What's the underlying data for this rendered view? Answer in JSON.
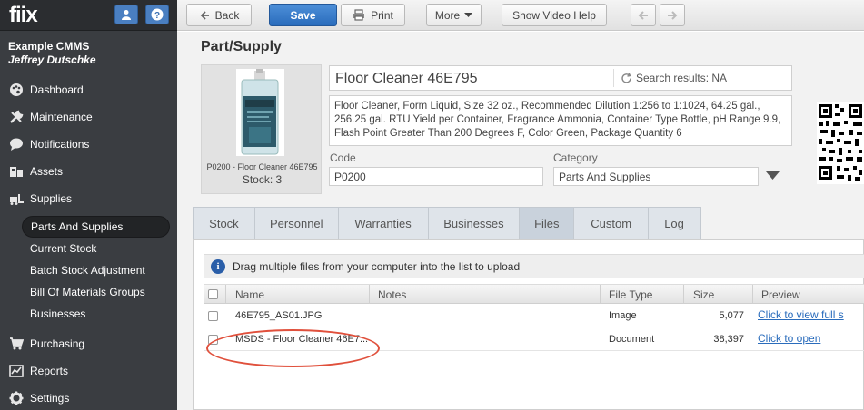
{
  "app": {
    "logo": "fiix",
    "org_name": "Example CMMS",
    "user_name": "Jeffrey Dutschke"
  },
  "sidebar": {
    "items": [
      {
        "label": "Dashboard",
        "icon": "palette-icon"
      },
      {
        "label": "Maintenance",
        "icon": "wrench-icon"
      },
      {
        "label": "Notifications",
        "icon": "chat-bubble-icon"
      },
      {
        "label": "Assets",
        "icon": "boxes-icon"
      },
      {
        "label": "Supplies",
        "icon": "forklift-icon"
      }
    ],
    "sub_items": [
      {
        "label": "Parts And Supplies",
        "active": true
      },
      {
        "label": "Current Stock"
      },
      {
        "label": "Batch Stock Adjustment"
      },
      {
        "label": "Bill Of Materials Groups"
      },
      {
        "label": "Businesses"
      }
    ],
    "bottom_items": [
      {
        "label": "Purchasing",
        "icon": "cart-icon"
      },
      {
        "label": "Reports",
        "icon": "chart-icon"
      },
      {
        "label": "Settings",
        "icon": "gear-icon"
      }
    ]
  },
  "toolbar": {
    "back": "Back",
    "save": "Save",
    "print": "Print",
    "more": "More",
    "video": "Show Video Help"
  },
  "page": {
    "title": "Part/Supply",
    "photo_caption": "P0200 - Floor Cleaner 46E795",
    "stock_caption": "Stock: 3",
    "name_value": "Floor Cleaner 46E795",
    "search_results": "Search results: NA",
    "description": "Floor Cleaner, Form Liquid, Size 32 oz., Recommended Dilution 1:256 to 1:1024, 64.25 gal., 256.25 gal. RTU Yield per Container, Fragrance Ammonia, Container Type Bottle, pH Range 9.9, Flash Point Greater Than 200 Degrees F, Color Green, Package Quantity 6",
    "code_label": "Code",
    "code_value": "P0200",
    "category_label": "Category",
    "category_value": "Parts And Supplies"
  },
  "tabs": [
    "Stock",
    "Personnel",
    "Warranties",
    "Businesses",
    "Files",
    "Custom",
    "Log"
  ],
  "files": {
    "info": "Drag multiple files from your computer into the list to upload",
    "columns": {
      "name": "Name",
      "notes": "Notes",
      "type": "File Type",
      "size": "Size",
      "preview": "Preview"
    },
    "rows": [
      {
        "name": "46E795_AS01.JPG",
        "notes": "",
        "type": "Image",
        "size": "5,077",
        "preview": "Click to view full s"
      },
      {
        "name": "MSDS - Floor Cleaner 46E7...",
        "notes": "",
        "type": "Document",
        "size": "38,397",
        "preview": "Click to open"
      }
    ]
  },
  "colors": {
    "sidebar_bg": "#3a3d41",
    "accent_blue": "#2a6cbc",
    "annotation_red": "#e0503c"
  }
}
